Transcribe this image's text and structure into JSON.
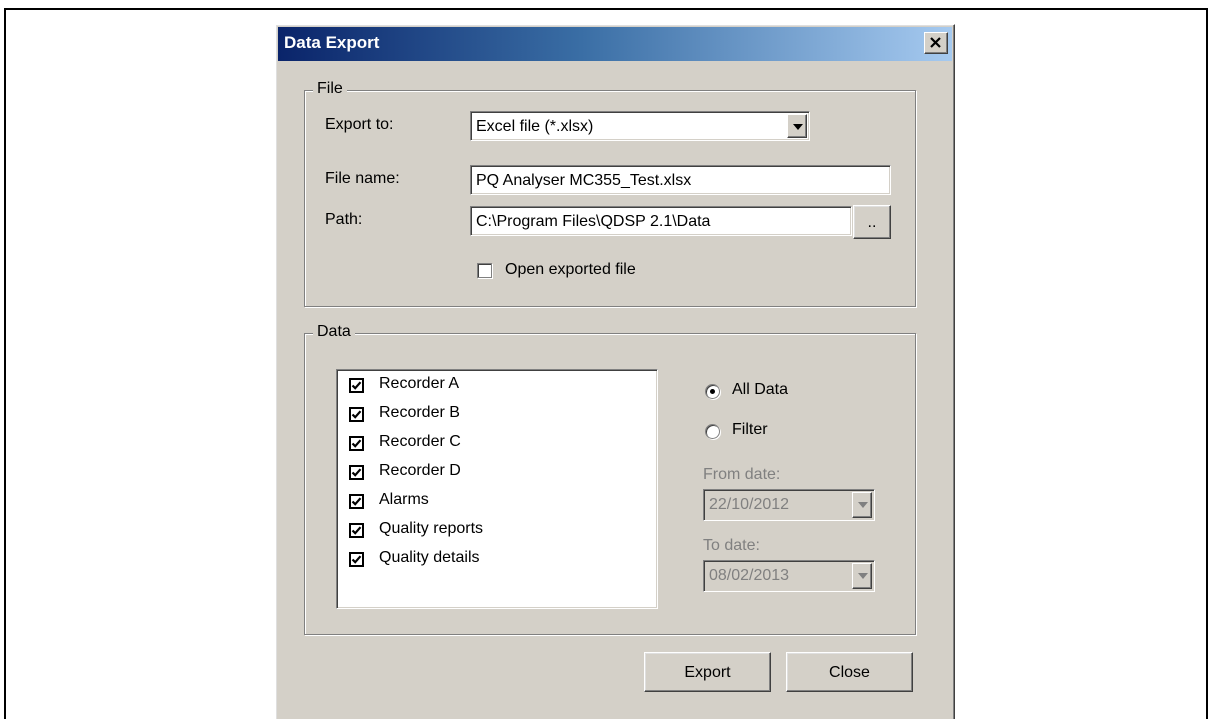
{
  "dialog": {
    "title": "Data Export",
    "close_glyph": "✕"
  },
  "file_group": {
    "legend": "File",
    "export_to_label": "Export to:",
    "export_to_value": "Excel file (*.xlsx)",
    "file_name_label": "File name:",
    "file_name_value": "PQ Analyser MC355_Test.xlsx",
    "path_label": "Path:",
    "path_value": "C:\\Program Files\\QDSP 2.1\\Data",
    "browse_label": "..",
    "open_exported_label": "Open exported file",
    "open_exported_checked": false
  },
  "data_group": {
    "legend": "Data",
    "items": [
      {
        "label": "Recorder A",
        "checked": true
      },
      {
        "label": "Recorder B",
        "checked": true
      },
      {
        "label": "Recorder C",
        "checked": true
      },
      {
        "label": "Recorder D",
        "checked": true
      },
      {
        "label": "Alarms",
        "checked": true
      },
      {
        "label": "Quality reports",
        "checked": true
      },
      {
        "label": "Quality details",
        "checked": true
      }
    ],
    "all_data_label": "All Data",
    "filter_label": "Filter",
    "selected_mode": "All Data",
    "from_date_label": "From date:",
    "from_date_value": "22/10/2012",
    "to_date_label": "To date:",
    "to_date_value": "08/02/2013"
  },
  "buttons": {
    "export_label": "Export",
    "close_label": "Close"
  },
  "icons": [
    "close-icon",
    "dropdown-arrow-icon",
    "checkbox-icon",
    "radio-icon"
  ]
}
